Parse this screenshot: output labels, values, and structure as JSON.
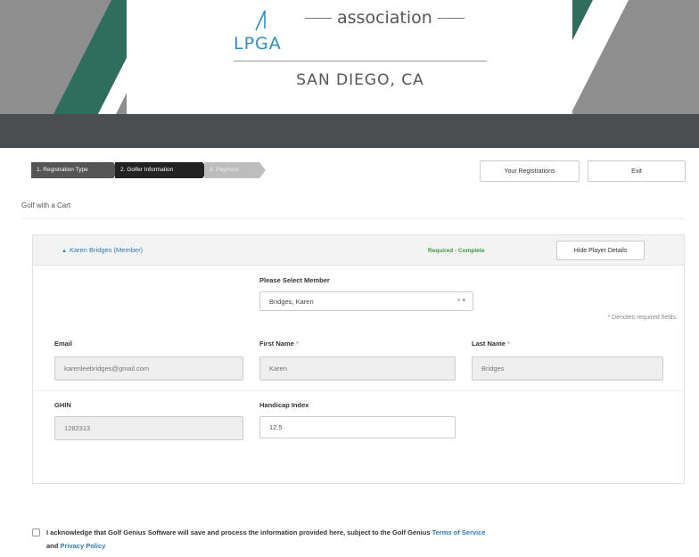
{
  "banner": {
    "brand": "LPGA",
    "association": "association",
    "city": "SAN DIEGO, CA"
  },
  "wizard": {
    "steps": [
      {
        "label": "1. Registration Type",
        "state": "done"
      },
      {
        "label": "2. Golfer Information",
        "state": "current"
      },
      {
        "label": "3. Payment",
        "state": "pending"
      }
    ],
    "your_registrations": "Your Registrations",
    "exit": "Exit"
  },
  "page": {
    "subtitle": "Golf with a Cart"
  },
  "player": {
    "name": "Karen Bridges (Member)",
    "status": "Required - Complete",
    "hide_details": "Hide Player Details",
    "select_member_label": "Please Select Member",
    "select_member_value": "Bridges, Karen",
    "required_note": "* Denotes required fields.",
    "fields": {
      "email": {
        "label": "Email",
        "value": "karenleebridges@gmail.com"
      },
      "first_name": {
        "label": "First Name",
        "value": "Karen"
      },
      "last_name": {
        "label": "Last Name",
        "value": "Bridges"
      },
      "ghin": {
        "label": "GHIN",
        "value": "1282313"
      },
      "handicap": {
        "label": "Handicap Index",
        "value": "12.5"
      }
    },
    "required_marker": "*"
  },
  "acknowledgement": {
    "text": "I acknowledge that Golf Genius Software will save and process the information provided here, subject to the Golf Genius",
    "terms_link": "Terms of Service",
    "and": "and",
    "privacy_link": "Privacy Policy"
  },
  "colors": {
    "banner_gray": "#8e8e8e",
    "stripe_green": "#2f6e5c",
    "dark_band": "#4b4e51",
    "link_blue": "#2e7ab8",
    "status_green": "#3a9b3a",
    "required_red": "#d9534f"
  },
  "icons": {
    "collapse": "triangle-up-icon",
    "select_clear": "clear-icon",
    "select_arrow": "chevron-down-icon"
  }
}
